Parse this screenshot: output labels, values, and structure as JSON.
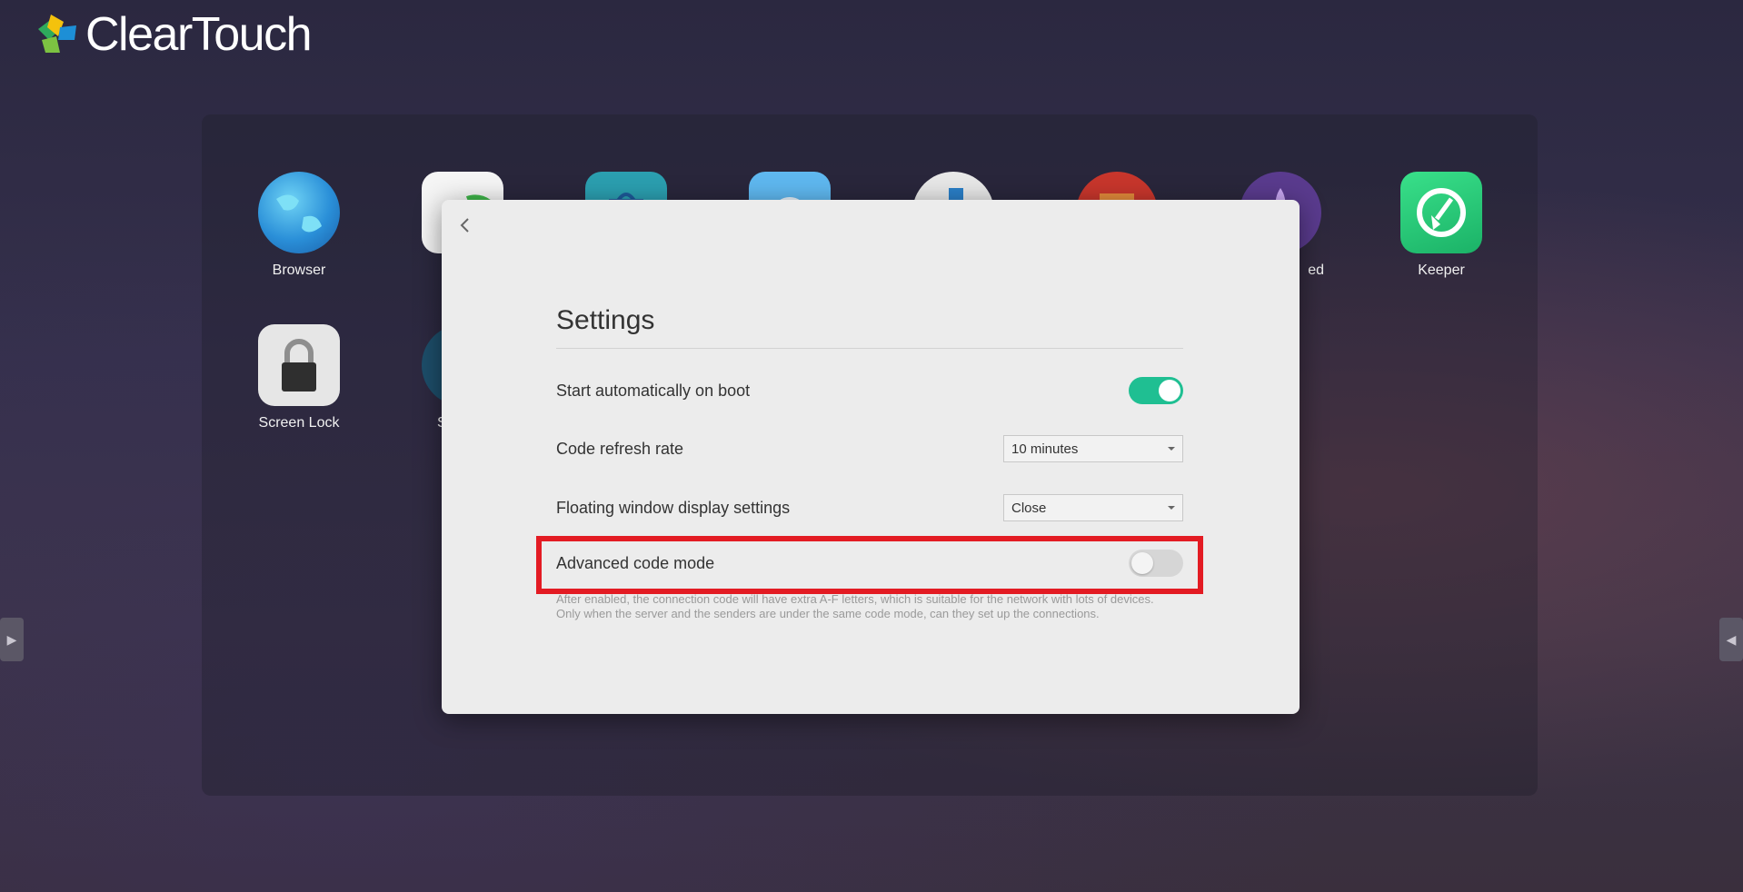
{
  "brand": {
    "logo_text": "ClearTouch"
  },
  "apps_row1": [
    {
      "label": "Browser",
      "icon": "globe-icon"
    },
    {
      "label": "",
      "icon": "partial-app-icon"
    },
    {
      "label": "",
      "icon": "shopping-bag-icon"
    },
    {
      "label": "",
      "icon": "chat-icon"
    },
    {
      "label": "",
      "icon": "partial-app-icon"
    },
    {
      "label": "",
      "icon": "folder-icon"
    },
    {
      "label": "ed",
      "icon": "rocket-icon"
    },
    {
      "label": "Keeper",
      "icon": "broom-icon"
    }
  ],
  "apps_row2": [
    {
      "label": "Screen Lock",
      "icon": "padlock-icon"
    },
    {
      "label": "S",
      "icon": "partial-app-icon"
    }
  ],
  "dialog": {
    "title": "Settings",
    "back_icon": "chevron-left-icon",
    "rows": {
      "autostart": {
        "label": "Start automatically on boot",
        "enabled": true
      },
      "refresh_rate": {
        "label": "Code refresh rate",
        "value": "10 minutes"
      },
      "floating_window": {
        "label": "Floating window display settings",
        "value": "Close"
      },
      "advanced_mode": {
        "label": "Advanced code mode",
        "enabled": false
      }
    },
    "help_text_line1": "After enabled, the connection code will have extra A-F letters, which is suitable for the network with lots of devices.",
    "help_text_line2": "Only when the server and the senders are under the same code mode, can they set up the connections."
  },
  "colors": {
    "accent": "#1fbf92",
    "highlight": "#e31b23",
    "dialog_bg": "#ececec"
  }
}
